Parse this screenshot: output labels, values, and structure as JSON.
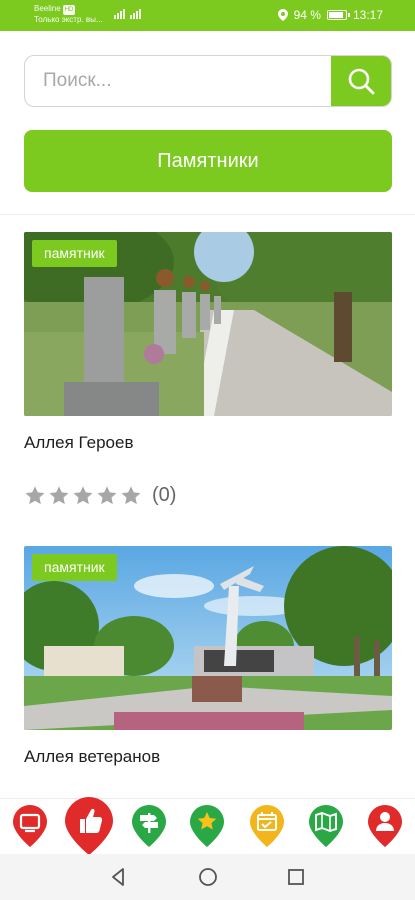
{
  "status_bar": {
    "carrier_line1": "Beeline",
    "carrier_badge": "HD",
    "carrier_line2": "Только экстр. вы...",
    "battery_text": "94 %",
    "battery_level": 0.94,
    "time": "13:17"
  },
  "search": {
    "placeholder": "Поиск...",
    "value": ""
  },
  "category": {
    "label": "Памятники"
  },
  "cards": [
    {
      "tag": "памятник",
      "title": "Аллея Героев",
      "rating_value": 0,
      "rating_count": "(0)"
    },
    {
      "tag": "памятник",
      "title": "Аллея ветеранов"
    }
  ],
  "bottom_nav": {
    "items": [
      {
        "icon": "tv-icon",
        "color": "#e12b2b"
      },
      {
        "icon": "thumbs-up-icon",
        "color": "#e12b2b",
        "active": true
      },
      {
        "icon": "signpost-icon",
        "color": "#2aa845"
      },
      {
        "icon": "star-icon",
        "color": "#2aa845"
      },
      {
        "icon": "calendar-icon",
        "color": "#f2b51c"
      },
      {
        "icon": "map-icon",
        "color": "#2aa845"
      },
      {
        "icon": "person-icon",
        "color": "#e12b2b"
      }
    ]
  },
  "colors": {
    "accent": "#7cc91f",
    "star_empty": "#a7a7a7"
  }
}
